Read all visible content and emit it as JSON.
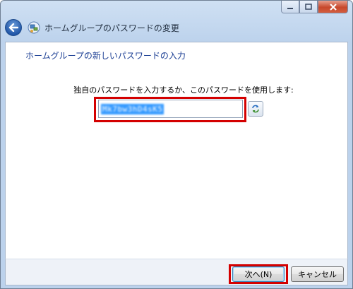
{
  "window": {
    "title": "ホームグループのパスワードの変更",
    "controls": {
      "minimize": "–",
      "maximize": "□",
      "close": "×"
    }
  },
  "content": {
    "instruction": "ホームグループの新しいパスワードの入力",
    "prompt": "独自のパスワードを入力するか、このパスワードを使用します:",
    "password_value": "Mk7bw3hD4sK5"
  },
  "footer": {
    "next_label": "次へ(N)",
    "cancel_label": "キャンセル"
  },
  "colors": {
    "highlight_outline": "#d40000",
    "selection": "#3399ff",
    "instruction_text": "#1c3f94"
  },
  "icons": {
    "back": "back-arrow-icon",
    "homegroup": "homegroup-icon",
    "refresh": "refresh-icon"
  }
}
